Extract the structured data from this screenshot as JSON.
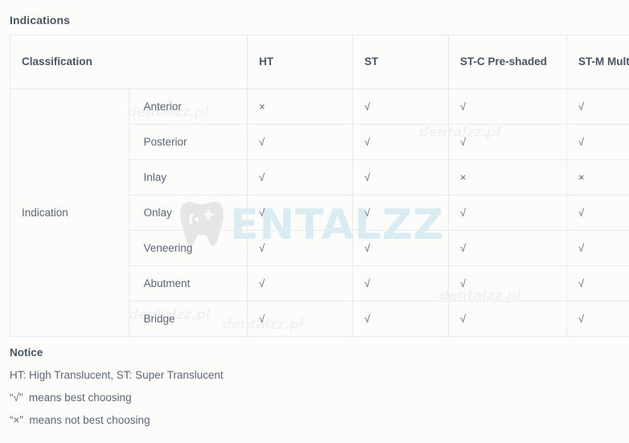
{
  "page": {
    "section_title": "Indications"
  },
  "table": {
    "headers": [
      {
        "label": "Classification",
        "key": "classification"
      },
      {
        "label": "HT",
        "key": "ht"
      },
      {
        "label": "ST",
        "key": "st"
      },
      {
        "label": "ST-C Pre-shaded",
        "key": "stc"
      },
      {
        "label": "ST-M Multilayer",
        "key": "stm"
      }
    ],
    "category_label": "Indication",
    "rows": [
      {
        "name": "Anterior",
        "ht": "×",
        "st": "√",
        "stc": "√",
        "stm": "√"
      },
      {
        "name": "Posterior",
        "ht": "√",
        "st": "√",
        "stc": "√",
        "stm": "√"
      },
      {
        "name": "Inlay",
        "ht": "√",
        "st": "√",
        "stc": "×",
        "stm": "×"
      },
      {
        "name": "Onlay",
        "ht": "√",
        "st": "√",
        "stc": "√",
        "stm": "√"
      },
      {
        "name": "Veneering",
        "ht": "√",
        "st": "√",
        "stc": "√",
        "stm": "√"
      },
      {
        "name": "Abutment",
        "ht": "√",
        "st": "√",
        "stc": "√",
        "stm": "√"
      },
      {
        "name": "Bridge",
        "ht": "√",
        "st": "√",
        "stc": "√",
        "stm": "√"
      }
    ]
  },
  "notice": {
    "title": "Notice",
    "lines": [
      "HT: High Translucent, ST: Super Translucent",
      "“√”  means best choosing",
      "“×”  means not best choosing"
    ]
  },
  "watermarks": {
    "brand_text": "ENTALZZ",
    "small_text": "dentalzz.pl",
    "brand_color": "#d9ecf4",
    "small_color": "#f2f2f2"
  },
  "colors": {
    "background": "#fcfdfb",
    "border": "#eaeaea",
    "heading_text": "#4a5565",
    "body_text": "#5b6775"
  }
}
